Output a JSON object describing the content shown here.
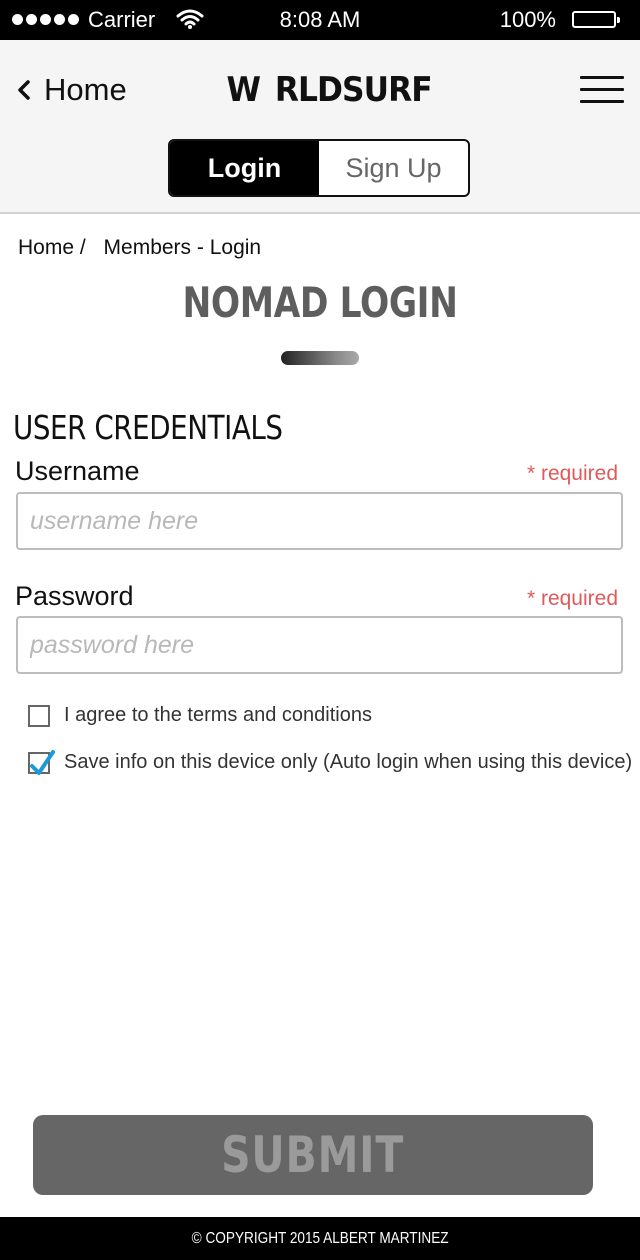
{
  "status_bar": {
    "carrier": "Carrier",
    "time": "8:08 AM",
    "battery_pct": "100%"
  },
  "header": {
    "back_label": "Home",
    "logo_prefix": "W",
    "logo_suffix": "RLDSURF",
    "tabs": [
      {
        "label": "Login",
        "active": true
      },
      {
        "label": "Sign Up",
        "active": false
      }
    ]
  },
  "breadcrumb": {
    "home": "Home /",
    "current": "Members - Login"
  },
  "page_title": "NOMAD LOGIN",
  "form": {
    "section_heading": "USER CREDENTIALS",
    "username": {
      "label": "Username",
      "required": "* required",
      "placeholder": "username here",
      "value": ""
    },
    "password": {
      "label": "Password",
      "required": "* required",
      "placeholder": "password here",
      "value": ""
    },
    "checkboxes": [
      {
        "label": "I agree to the terms and conditions",
        "checked": false
      },
      {
        "label": "Save info on this device only (Auto login when using this device)",
        "checked": true
      }
    ],
    "submit_label": "SUBMIT"
  },
  "footer": {
    "copyright": "© COPYRIGHT 2015 ALBERT MARTINEZ"
  },
  "colors": {
    "accent_check": "#1a9bd7",
    "required": "#e05a5a",
    "submit_bg": "#666666"
  },
  "icons": [
    "signal-dots-icon",
    "wifi-icon",
    "battery-icon",
    "chevron-left-icon",
    "surfboard-icon",
    "hamburger-menu-icon",
    "checkmark-icon"
  ]
}
